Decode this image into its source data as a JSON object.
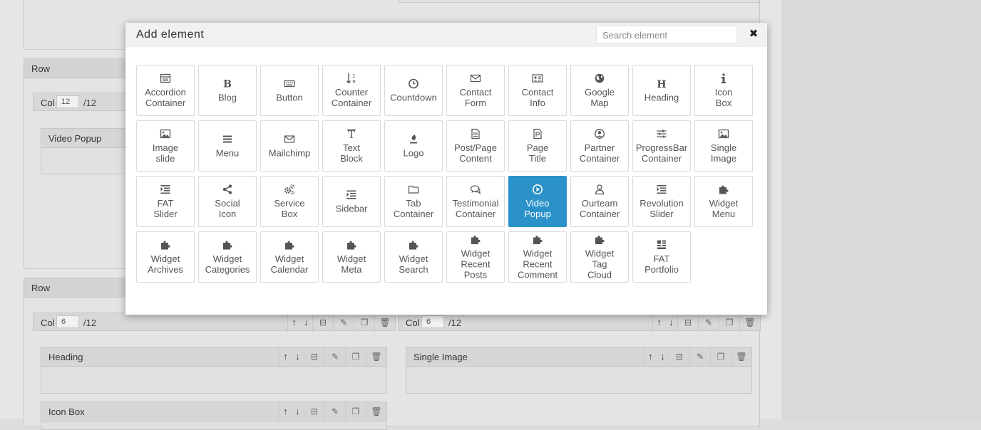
{
  "modal": {
    "title": "Add element",
    "search_placeholder": "Search element",
    "close_symbol": "✖",
    "elements": [
      {
        "label": "Accordion\nContainer",
        "icon": "accordion-icon"
      },
      {
        "label": "Blog",
        "icon": "blog-icon"
      },
      {
        "label": "Button",
        "icon": "keyboard-icon"
      },
      {
        "label": "Counter\nContainer",
        "icon": "counter-icon"
      },
      {
        "label": "Countdown",
        "icon": "clock-icon"
      },
      {
        "label": "Contact\nForm",
        "icon": "envelope-icon"
      },
      {
        "label": "Contact\nInfo",
        "icon": "contact-card-icon"
      },
      {
        "label": "Google\nMap",
        "icon": "globe-icon"
      },
      {
        "label": "Heading",
        "icon": "heading-icon"
      },
      {
        "label": "Icon\nBox",
        "icon": "info-icon"
      },
      {
        "label": "Image\nslide",
        "icon": "image-icon"
      },
      {
        "label": "Menu",
        "icon": "menu-icon"
      },
      {
        "label": "Mailchimp",
        "icon": "envelope-icon"
      },
      {
        "label": "Text\nBlock",
        "icon": "text-icon"
      },
      {
        "label": "Logo",
        "icon": "logo-icon"
      },
      {
        "label": "Post/Page\nContent",
        "icon": "document-icon"
      },
      {
        "label": "Page\nTitle",
        "icon": "page-title-icon"
      },
      {
        "label": "Partner\nContainer",
        "icon": "user-circle-icon"
      },
      {
        "label": "ProgressBar\nContainer",
        "icon": "sliders-icon"
      },
      {
        "label": "Single\nImage",
        "icon": "image-icon"
      },
      {
        "label": "FAT\nSlider",
        "icon": "indent-icon"
      },
      {
        "label": "Social\nIcon",
        "icon": "share-icon"
      },
      {
        "label": "Service\nBox",
        "icon": "cogs-icon"
      },
      {
        "label": "Sidebar",
        "icon": "indent-icon"
      },
      {
        "label": "Tab\nContainer",
        "icon": "folder-icon"
      },
      {
        "label": "Testimonial\nContainer",
        "icon": "comments-icon"
      },
      {
        "label": "Video\nPopup",
        "icon": "play-circle-icon",
        "active": true
      },
      {
        "label": "Ourteam\nContainer",
        "icon": "user-icon"
      },
      {
        "label": "Revolution\nSlider",
        "icon": "indent-icon"
      },
      {
        "label": "Widget\nMenu",
        "icon": "puzzle-icon"
      },
      {
        "label": "Widget\nArchives",
        "icon": "puzzle-icon"
      },
      {
        "label": "Widget\nCategories",
        "icon": "puzzle-icon"
      },
      {
        "label": "Widget\nCalendar",
        "icon": "puzzle-icon"
      },
      {
        "label": "Widget\nMeta",
        "icon": "puzzle-icon"
      },
      {
        "label": "Widget\nSearch",
        "icon": "puzzle-icon"
      },
      {
        "label": "Widget\nRecent\nPosts",
        "icon": "puzzle-icon"
      },
      {
        "label": "Widget\nRecent\nComment",
        "icon": "puzzle-icon"
      },
      {
        "label": "Widget\nTag\nCloud",
        "icon": "puzzle-icon"
      },
      {
        "label": "FAT\nPortfolio",
        "icon": "portfolio-icon"
      }
    ]
  },
  "background": {
    "row1_title": "Row",
    "row1_col_label": "Col",
    "row1_col_value": "12",
    "row1_col_denom": "/12",
    "row1_element": "Video Popup",
    "row2_title": "Row",
    "row2_col1_label": "Col",
    "row2_col1_value": "6",
    "row2_col1_denom": "/12",
    "row2_col2_label": "Col",
    "row2_col2_value": "6",
    "row2_col2_denom": "/12",
    "heading_element": "Heading",
    "iconbox_element": "Icon Box",
    "single_image_element": "Single Image"
  },
  "colors": {
    "active_tile": "#2a92c9",
    "overlay": "#e6e6e6"
  }
}
